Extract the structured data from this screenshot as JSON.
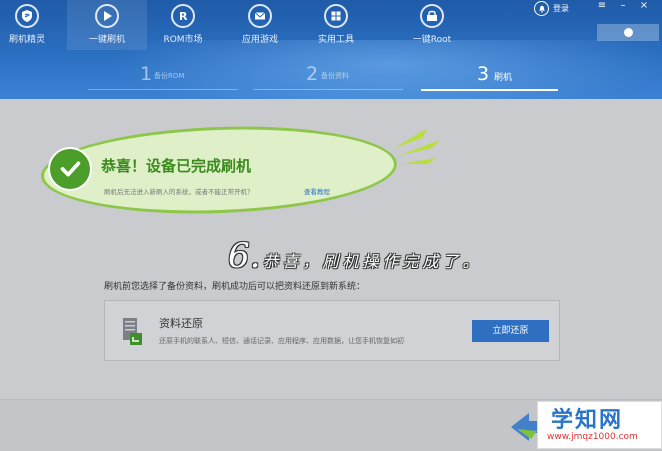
{
  "app": {
    "nav": [
      {
        "label": "刷机精灵",
        "icon": "shield-icon"
      },
      {
        "label": "一键刷机",
        "icon": "play-icon",
        "active": true
      },
      {
        "label": "ROM市场",
        "icon": "rom-icon"
      },
      {
        "label": "应用游戏",
        "icon": "mail-icon"
      },
      {
        "label": "实用工具",
        "icon": "grid-icon"
      },
      {
        "label": "一键Root",
        "icon": "root-icon"
      }
    ],
    "login_label": "登录"
  },
  "steps": [
    {
      "num": "1",
      "label": "备份ROM"
    },
    {
      "num": "2",
      "label": "备份资料"
    },
    {
      "num": "3",
      "label": "刷机",
      "current": true
    }
  ],
  "success": {
    "title": "恭喜！设备已完成刷机",
    "description": "刷机后无法进入新刷入的系统，或者不能正常开机？",
    "link": "查看教程"
  },
  "annotation": {
    "number": "6.",
    "text": "恭喜，刷机操作完成了。"
  },
  "backup": {
    "prompt": "刷机前您选择了备份资料，刷机成功后可以把资料还原到新系统：",
    "card": {
      "title": "资料还原",
      "description": "还原手机的联系人、短信、通话记录、应用程序、应用数据，让您手机恢复如初",
      "button": "立即还原"
    }
  },
  "watermark": {
    "title": "学知网",
    "url": "www.jmqz1000.com"
  },
  "colors": {
    "header": "#2b6fc1",
    "success_green": "#3a8a1d",
    "bubble_fill": "#dff0c8",
    "button_blue": "#2e6fc2"
  }
}
